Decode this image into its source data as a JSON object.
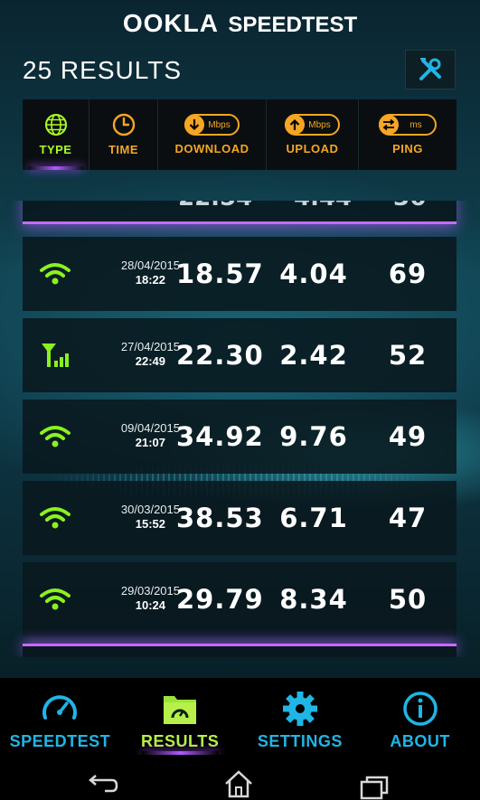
{
  "header": {
    "brand_ookla": "OOKLA",
    "brand_product": "SPEEDTEST",
    "results_count": "25 RESULTS"
  },
  "sortbar": {
    "columns": [
      {
        "label": "TYPE",
        "icon": "globe-icon",
        "active": true
      },
      {
        "label": "TIME",
        "icon": "clock-icon",
        "active": false
      },
      {
        "label": "DOWNLOAD",
        "icon": "download-arrow-icon",
        "unit": "Mbps",
        "active": false
      },
      {
        "label": "UPLOAD",
        "icon": "upload-arrow-icon",
        "unit": "Mbps",
        "active": false
      },
      {
        "label": "PING",
        "icon": "ping-arrows-icon",
        "unit": "ms",
        "active": false
      }
    ]
  },
  "results": [
    {
      "type": "wifi",
      "icon": "wifi-icon",
      "date": "28/04/2015",
      "time": "18:22",
      "download": "18.57",
      "upload": "4.04",
      "ping": "69"
    },
    {
      "type": "cellular",
      "icon": "cell-signal-icon",
      "date": "27/04/2015",
      "time": "22:49",
      "download": "22.30",
      "upload": "2.42",
      "ping": "52"
    },
    {
      "type": "wifi",
      "icon": "wifi-icon",
      "date": "09/04/2015",
      "time": "21:07",
      "download": "34.92",
      "upload": "9.76",
      "ping": "49"
    },
    {
      "type": "wifi",
      "icon": "wifi-icon",
      "date": "30/03/2015",
      "time": "15:52",
      "download": "38.53",
      "upload": "6.71",
      "ping": "47"
    },
    {
      "type": "wifi",
      "icon": "wifi-icon",
      "date": "29/03/2015",
      "time": "10:24",
      "download": "29.79",
      "upload": "8.34",
      "ping": "50"
    }
  ],
  "nav": {
    "items": [
      {
        "label": "SPEEDTEST",
        "icon": "speedometer-icon",
        "active": false
      },
      {
        "label": "RESULTS",
        "icon": "results-folder-icon",
        "active": true
      },
      {
        "label": "SETTINGS",
        "icon": "gear-icon",
        "active": false
      },
      {
        "label": "ABOUT",
        "icon": "info-icon",
        "active": false
      }
    ]
  },
  "colors": {
    "accent_orange": "#f5a623",
    "accent_green": "#aaff22",
    "accent_blue": "#1fb6e6",
    "accent_purple": "#b25cff"
  }
}
